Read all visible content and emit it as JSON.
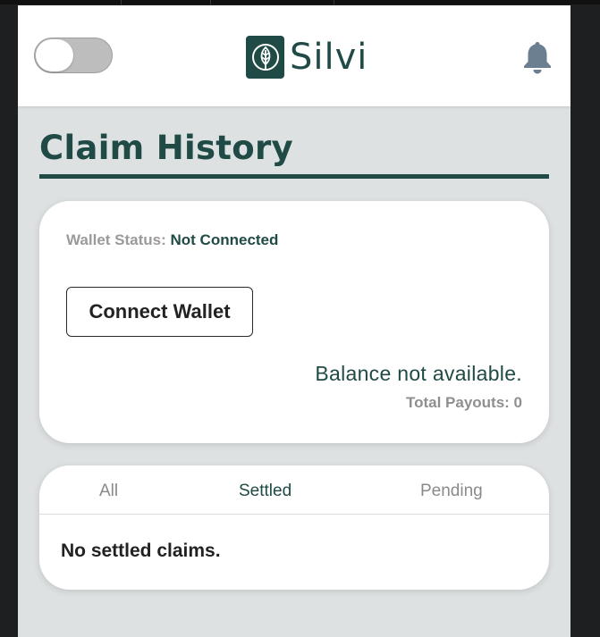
{
  "brand": {
    "name": "Silvi",
    "color": "#1f4a45"
  },
  "header": {
    "toggle_state": "off",
    "notification_icon": "bell-icon"
  },
  "page": {
    "title": "Claim History"
  },
  "wallet": {
    "status_label": "Wallet Status:",
    "status_value": "Not Connected",
    "connect_button": "Connect Wallet",
    "balance_text": "Balance not available.",
    "payouts_text": "Total Payouts: 0"
  },
  "claims": {
    "tabs": [
      {
        "label": "All",
        "active": false
      },
      {
        "label": "Settled",
        "active": true
      },
      {
        "label": "Pending",
        "active": false
      }
    ],
    "empty_text": "No settled claims."
  }
}
